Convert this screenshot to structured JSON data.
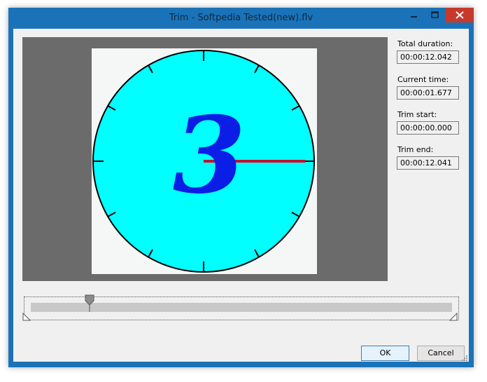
{
  "window": {
    "title": "Trim - Softpedia Tested(new).flv",
    "controls": {
      "minimize": "minimize-icon",
      "maximize": "maximize-icon",
      "close": "close-icon"
    }
  },
  "preview": {
    "clock_number": "3",
    "colors": {
      "face": "#00ffff",
      "number": "#0a1ee6",
      "hand": "#c8102e",
      "background": "#6b6b6b"
    }
  },
  "info": {
    "total_duration_label": "Total duration:",
    "total_duration_value": "00:00:12.042",
    "current_time_label": "Current time:",
    "current_time_value": "00:00:01.677",
    "trim_start_label": "Trim start:",
    "trim_start_value": "00:00:00.000",
    "trim_end_label": "Trim end:",
    "trim_end_value": "00:00:12.041"
  },
  "timeline": {
    "position_fraction": 0.139
  },
  "buttons": {
    "ok": "OK",
    "cancel": "Cancel"
  }
}
